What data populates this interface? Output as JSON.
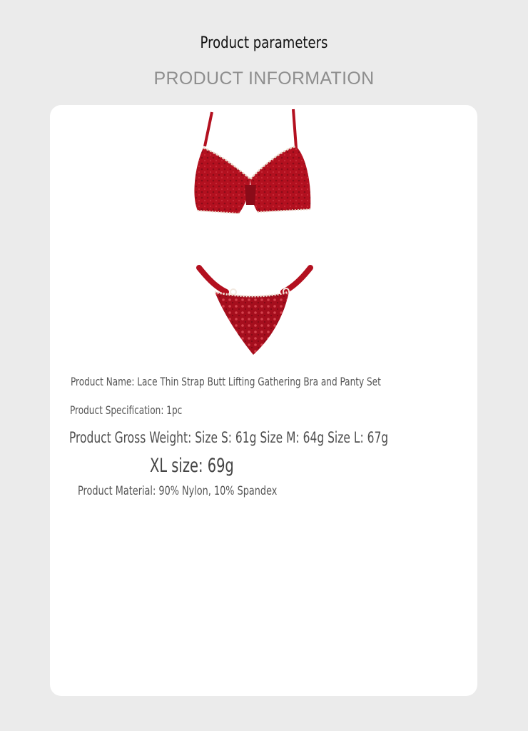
{
  "header": {
    "title": "Product parameters",
    "subtitle": "PRODUCT INFORMATION"
  },
  "product": {
    "name_line": "Product Name: Lace Thin Strap Butt Lifting Gathering Bra and Panty Set",
    "specification_line": "Product Specification: 1pc",
    "gross_weight_line": "Product Gross Weight: Size S: 61g Size M: 64g Size L: 67g",
    "xl_size_line": "XL size: 69g",
    "material_line": "Product Material: 90% Nylon, 10% Spandex"
  },
  "colors": {
    "page_background": "#ebebeb",
    "card_background": "#ffffff",
    "garment_red": "#b3101f",
    "garment_dark_red": "#8a0b18"
  }
}
